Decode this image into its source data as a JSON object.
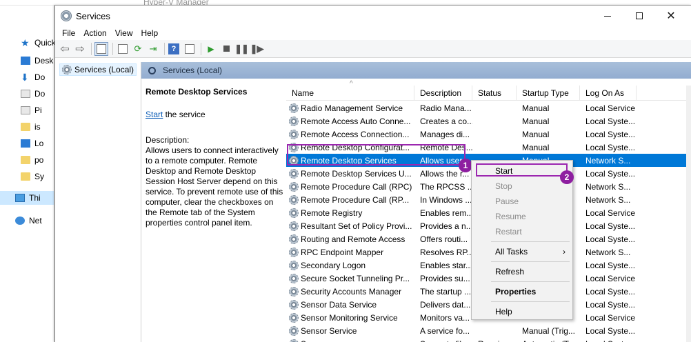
{
  "bg_explorer": {
    "title": "Hyper-V Manager",
    "nav": [
      {
        "label": "Quick",
        "icon": "star-icon"
      },
      {
        "label": "Desk",
        "icon": "desktop-icon"
      },
      {
        "label": "Do",
        "icon": "download-icon"
      },
      {
        "label": "Do",
        "icon": "document-icon"
      },
      {
        "label": "Pi",
        "icon": "pictures-icon"
      },
      {
        "label": "is",
        "icon": "folder-icon"
      },
      {
        "label": "Lo",
        "icon": "local-folder-icon"
      },
      {
        "label": "po",
        "icon": "folder-icon"
      },
      {
        "label": "Sy",
        "icon": "folder-icon"
      },
      {
        "label": "Thi",
        "icon": "this-pc-icon"
      },
      {
        "label": "Net",
        "icon": "network-icon"
      }
    ]
  },
  "window": {
    "title": "Services",
    "menu": [
      "File",
      "Action",
      "View",
      "Help"
    ]
  },
  "tree": {
    "root": "Services (Local)"
  },
  "content": {
    "header": "Services (Local)",
    "detail": {
      "service_name": "Remote Desktop Services",
      "start_link": "Start",
      "start_suffix": " the service",
      "description_label": "Description:",
      "description": "Allows users to connect interactively to a remote computer. Remote Desktop and Remote Desktop Session Host Server depend on this service. To prevent remote use of this computer, clear the checkboxes on the Remote tab of the System properties control panel item."
    },
    "columns": [
      "Name",
      "Description",
      "Status",
      "Startup Type",
      "Log On As"
    ],
    "rows": [
      {
        "name": "Radio Management Service",
        "desc": "Radio Mana...",
        "status": "",
        "startup": "Manual",
        "logon": "Local Service"
      },
      {
        "name": "Remote Access Auto Conne...",
        "desc": "Creates a co...",
        "status": "",
        "startup": "Manual",
        "logon": "Local Syste..."
      },
      {
        "name": "Remote Access Connection...",
        "desc": "Manages di...",
        "status": "",
        "startup": "Manual",
        "logon": "Local Syste..."
      },
      {
        "name": "Remote Desktop Configurat...",
        "desc": "Remote Des...",
        "status": "",
        "startup": "Manual",
        "logon": "Local Syste..."
      },
      {
        "name": "Remote Desktop Services",
        "desc": "Allows user...",
        "status": "",
        "startup": "Manual",
        "logon": "Network S..."
      },
      {
        "name": "Remote Desktop Services U...",
        "desc": "Allows the r...",
        "status": "",
        "startup": "",
        "logon": "Local Syste..."
      },
      {
        "name": "Remote Procedure Call (RPC)",
        "desc": "The RPCSS ...",
        "status": "",
        "startup": "",
        "logon": "Network S..."
      },
      {
        "name": "Remote Procedure Call (RP...",
        "desc": "In Windows ...",
        "status": "",
        "startup": "",
        "logon": "Network S..."
      },
      {
        "name": "Remote Registry",
        "desc": "Enables rem...",
        "status": "",
        "startup": "",
        "logon": "Local Service"
      },
      {
        "name": "Resultant Set of Policy Provi...",
        "desc": "Provides a n...",
        "status": "",
        "startup": "",
        "logon": "Local Syste..."
      },
      {
        "name": "Routing and Remote Access",
        "desc": "Offers routi...",
        "status": "",
        "startup": "",
        "logon": "Local Syste..."
      },
      {
        "name": "RPC Endpoint Mapper",
        "desc": "Resolves RP...",
        "status": "",
        "startup": "",
        "logon": "Network S..."
      },
      {
        "name": "Secondary Logon",
        "desc": "Enables star...",
        "status": "",
        "startup": "",
        "logon": "Local Syste..."
      },
      {
        "name": "Secure Socket Tunneling Pr...",
        "desc": "Provides su...",
        "status": "",
        "startup": "",
        "logon": "Local Service"
      },
      {
        "name": "Security Accounts Manager",
        "desc": "The startup ...",
        "status": "",
        "startup": "",
        "logon": "Local Syste..."
      },
      {
        "name": "Sensor Data Service",
        "desc": "Delivers dat...",
        "status": "",
        "startup": "",
        "logon": "Local Syste..."
      },
      {
        "name": "Sensor Monitoring Service",
        "desc": "Monitors va...",
        "status": "",
        "startup": "",
        "logon": "Local Service"
      },
      {
        "name": "Sensor Service",
        "desc": "A service fo...",
        "status": "",
        "startup": "Manual (Trig...",
        "logon": "Local Syste..."
      },
      {
        "name": "Server",
        "desc": "Supports fil...",
        "status": "Running",
        "startup": "Automatic (T...",
        "logon": "Local Syste..."
      }
    ],
    "selected_index": 4
  },
  "context_menu": {
    "items": [
      {
        "label": "Start",
        "state": "enabled"
      },
      {
        "label": "Stop",
        "state": "disabled"
      },
      {
        "label": "Pause",
        "state": "disabled"
      },
      {
        "label": "Resume",
        "state": "disabled"
      },
      {
        "label": "Restart",
        "state": "disabled"
      },
      {
        "label": "All Tasks",
        "state": "submenu"
      },
      {
        "label": "Refresh",
        "state": "enabled"
      },
      {
        "label": "Properties",
        "state": "bold"
      },
      {
        "label": "Help",
        "state": "enabled"
      }
    ]
  },
  "annotations": {
    "badge1": "1",
    "badge2": "2",
    "color": "#9c27b0"
  },
  "colors": {
    "selection": "#0078d7",
    "header_band": "#a8bfda"
  }
}
